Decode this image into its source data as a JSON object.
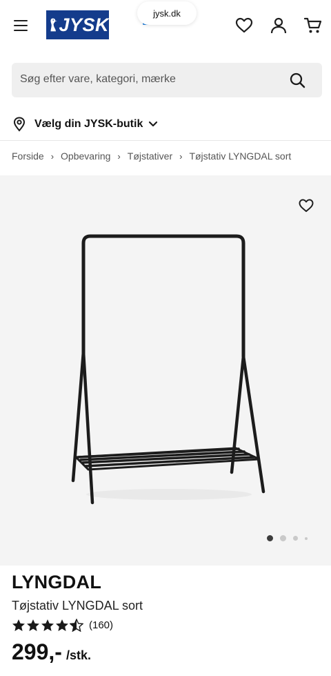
{
  "browser": {
    "url": "jysk.dk"
  },
  "header": {
    "logo_text": "JYSK",
    "brand_color": "#143c8c"
  },
  "search": {
    "placeholder": "Søg efter vare, kategori, mærke"
  },
  "store_selector": {
    "label": "Vælg din JYSK-butik"
  },
  "breadcrumbs": [
    "Forside",
    "Opbevaring",
    "Tøjstativer",
    "Tøjstativ LYNGDAL sort"
  ],
  "product": {
    "name": "LYNGDAL",
    "subtitle": "Tøjstativ LYNGDAL sort",
    "rating": 4.5,
    "rating_max": 5,
    "review_count": "(160)",
    "price": "299,-",
    "price_unit": "/stk."
  },
  "gallery": {
    "image_count": 4,
    "active_index": 0
  }
}
